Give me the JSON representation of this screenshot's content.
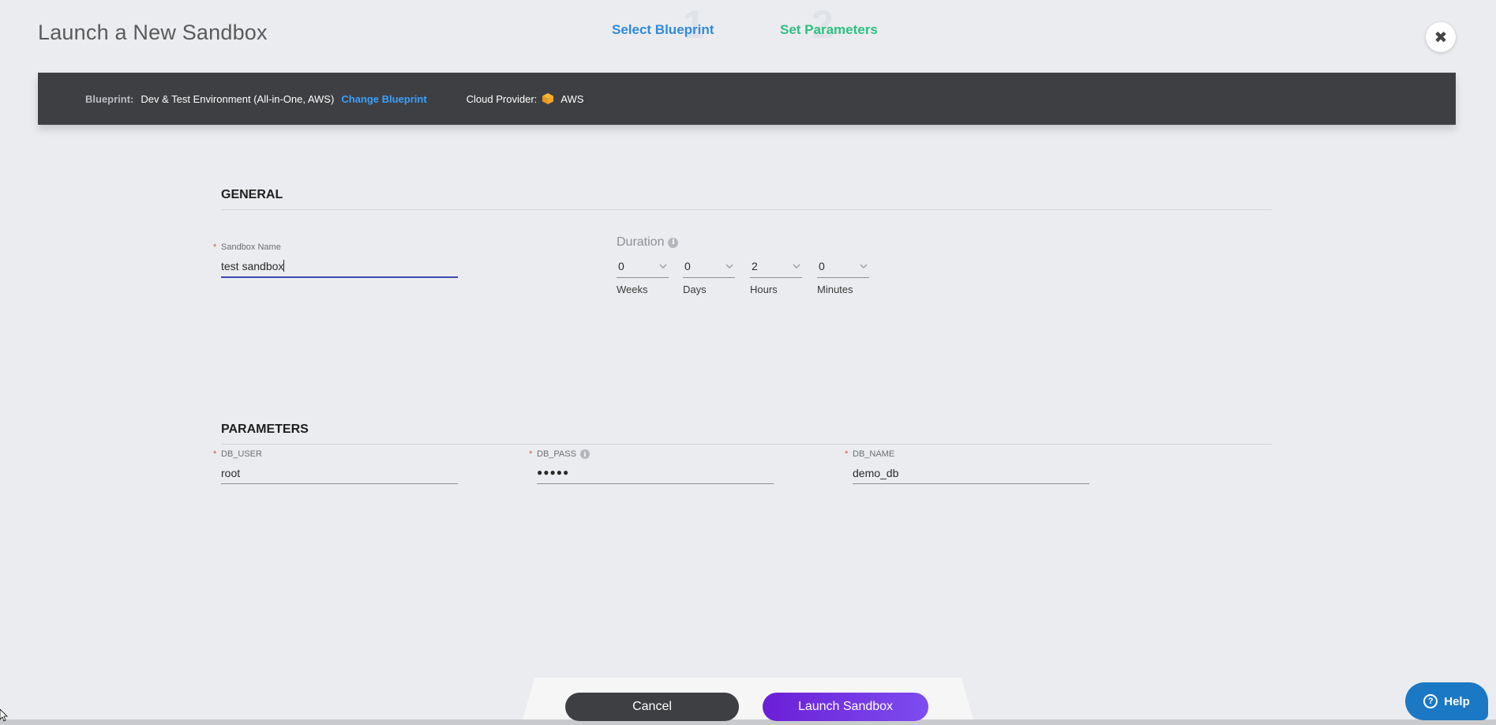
{
  "header": {
    "title": "Launch a New Sandbox",
    "steps": [
      {
        "number": "1",
        "label": "Select Blueprint"
      },
      {
        "number": "2",
        "label": "Set Parameters"
      }
    ],
    "close_icon": "close-icon"
  },
  "blueprint_bar": {
    "blueprint_label": "Blueprint:",
    "blueprint_name": "Dev & Test Environment (All-in-One, AWS)",
    "change_link": "Change Blueprint",
    "cloud_provider_label": "Cloud Provider:",
    "cloud_provider_icon": "aws-box-icon",
    "cloud_provider_value": "AWS"
  },
  "general": {
    "section_title": "GENERAL",
    "sandbox_name": {
      "label": "Sandbox Name",
      "required": "*",
      "value": "test sandbox"
    },
    "duration": {
      "label": "Duration",
      "fields": [
        {
          "value": "0",
          "caption": "Weeks"
        },
        {
          "value": "0",
          "caption": "Days"
        },
        {
          "value": "2",
          "caption": "Hours"
        },
        {
          "value": "0",
          "caption": "Minutes"
        }
      ]
    }
  },
  "parameters": {
    "section_title": "PARAMETERS",
    "fields": [
      {
        "label": "DB_USER",
        "required": "*",
        "value": "root"
      },
      {
        "label": "DB_PASS",
        "required": "*",
        "value": "●●●●●"
      },
      {
        "label": "DB_NAME",
        "required": "*",
        "value": "demo_db"
      }
    ]
  },
  "footer": {
    "cancel_label": "Cancel",
    "launch_label": "Launch Sandbox"
  },
  "help": {
    "label": "Help"
  },
  "colors": {
    "accent_blue": "#2f8ad8",
    "accent_green": "#2fbf83",
    "launch_purple": "#6b1fd6",
    "bar_dark": "#3e3f42"
  }
}
